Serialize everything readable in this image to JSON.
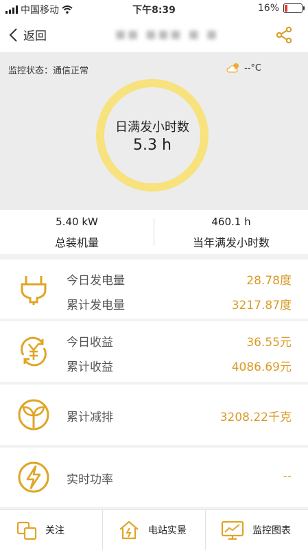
{
  "status_bar": {
    "carrier": "中国移动",
    "time": "下午8:39",
    "battery": "16%",
    "battery_level": 0.16
  },
  "nav": {
    "back_label": "返回",
    "title": "■■ ■■■ ■ ■"
  },
  "hero": {
    "monitor_status": "监控状态：通信正常",
    "temperature": "--°C",
    "ring_label": "日满发小时数",
    "ring_value": "5.3 h"
  },
  "stats": [
    {
      "value": "5.40 kW",
      "label": "总装机量"
    },
    {
      "value": "460.1 h",
      "label": "当年满发小时数"
    }
  ],
  "cards": [
    {
      "icon": "plug-icon",
      "rows": [
        {
          "label": "今日发电量",
          "value": "28.78度"
        },
        {
          "label": "累计发电量",
          "value": "3217.87度"
        }
      ]
    },
    {
      "icon": "yuan-icon",
      "rows": [
        {
          "label": "今日收益",
          "value": "36.55元"
        },
        {
          "label": "累计收益",
          "value": "4086.69元"
        }
      ]
    },
    {
      "icon": "leaf-icon",
      "rows": [
        {
          "label": "累计减排",
          "value": "3208.22千克"
        }
      ]
    },
    {
      "icon": "lightning-icon",
      "rows": [
        {
          "label": "实时功率",
          "value": "--"
        }
      ]
    }
  ],
  "tabs": [
    {
      "label": "关注",
      "icon": "follow-icon"
    },
    {
      "label": "电站实景",
      "icon": "house-icon"
    },
    {
      "label": "监控图表",
      "icon": "monitor-chart-icon"
    }
  ],
  "colors": {
    "accent": "#d99a26",
    "ring": "#f7e27e",
    "icon": "#e0a526",
    "battery": "#e53935"
  }
}
